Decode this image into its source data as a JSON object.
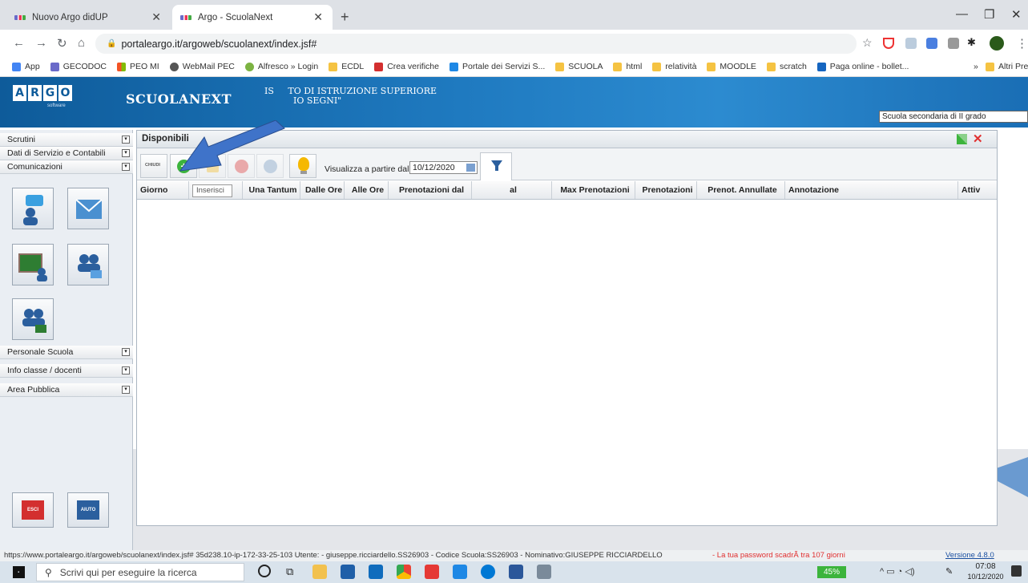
{
  "browser": {
    "tabs": [
      {
        "title": "Nuovo Argo didUP"
      },
      {
        "title": "Argo - ScuolaNext"
      }
    ],
    "url": "portaleargo.it/argoweb/scuolanext/index.jsf#",
    "bookmarks": [
      "App",
      "GECODOC",
      "PEO MI",
      "WebMail PEC",
      "Alfresco » Login",
      "ECDL",
      "Crea verifiche",
      "Portale dei Servizi S...",
      "SCUOLA",
      "html",
      "relatività",
      "MOODLE",
      "scratch",
      "Paga online - bollet..."
    ],
    "more_bookmarks": "»",
    "other_bookmarks": "Altri Preferiti"
  },
  "app": {
    "logo_letters": [
      "A",
      "R",
      "G",
      "O"
    ],
    "logo_sub": "software",
    "product": "SCUOLANEXT",
    "institute_line1": "IS     TO DI ISTRUZIONE SUPERIORE",
    "institute_line2": "IO SEGNI\"",
    "school_type": "Scuola secondaria di II grado"
  },
  "sidebar": {
    "items_top": [
      "Scrutini",
      "Dati di Servizio e Contabili",
      "Comunicazioni"
    ],
    "items_bottom": [
      "Personale Scuola",
      "Info classe / docenti",
      "Area Pubblica"
    ],
    "toggle": "▾",
    "exit_label": "ESCI",
    "help_label": "AIUTO"
  },
  "panel": {
    "title": "Disponibili",
    "close_label": "CHIUDI",
    "filter_label": "Visualizza a partire dal:",
    "filter_date": "10/12/2020",
    "tooltip": "Inserisci",
    "columns": [
      "Giorno",
      "",
      "Una Tantum",
      "Dalle Ore",
      "Alle Ore",
      "Prenotazioni dal",
      "al",
      "Max Prenotazioni",
      "Prenotazioni",
      "Prenot. Annullate",
      "Annotazione",
      "Attiv"
    ]
  },
  "status": {
    "text": "https://www.portaleargo.it/argoweb/scuolanext/index.jsf# 35d238.10-ip-172-33-25-103 Utente: - giuseppe.ricciardello.SS26903 - Codice Scuola:SS26903 - Nominativo:GIUSEPPE RICCIARDELLO",
    "warning": "- La tua password scadrÃ  tra 107 giorni",
    "version": "Versione 4.8.0"
  },
  "taskbar": {
    "search_placeholder": "Scrivi qui per eseguire la ricerca",
    "battery": "45%",
    "time": "07:08",
    "date": "10/12/2020"
  },
  "colors": {
    "header_blue": "#1f7ac0",
    "accent_green": "#3cb43c",
    "arrow_blue": "#3f73c9",
    "warning_red": "#e03030"
  }
}
